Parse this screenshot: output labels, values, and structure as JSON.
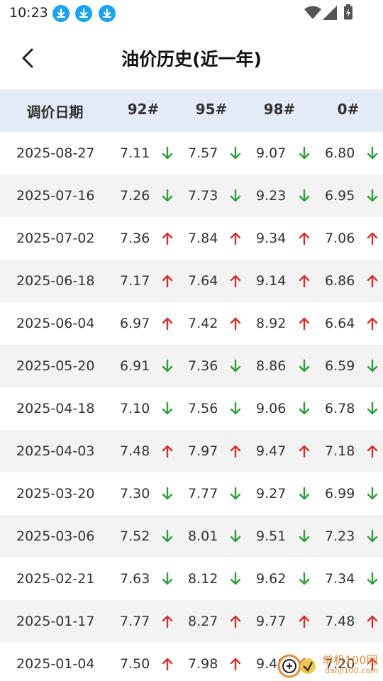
{
  "status_bar": {
    "time": "10:23",
    "notification_icons": [
      "download-icon",
      "download-icon",
      "download-icon"
    ],
    "right_icons": [
      "wifi-icon",
      "signal-icon",
      "battery-charging-icon"
    ]
  },
  "header": {
    "title": "油价历史(近一年)",
    "back_icon": "chevron-left-icon"
  },
  "table": {
    "columns": [
      "调价日期",
      "92#",
      "95#",
      "98#",
      "0#"
    ],
    "colors": {
      "up": "#d32f2f",
      "down": "#2e9d3a",
      "header_bg": "#e4eaf6",
      "alt_row_bg": "#f3f3f3"
    },
    "rows": [
      {
        "date": "2025-08-27",
        "p92": "7.11",
        "p95": "7.57",
        "p98": "9.07",
        "p0": "6.80",
        "trend": "down"
      },
      {
        "date": "2025-07-16",
        "p92": "7.26",
        "p95": "7.73",
        "p98": "9.23",
        "p0": "6.95",
        "trend": "down"
      },
      {
        "date": "2025-07-02",
        "p92": "7.36",
        "p95": "7.84",
        "p98": "9.34",
        "p0": "7.06",
        "trend": "up"
      },
      {
        "date": "2025-06-18",
        "p92": "7.17",
        "p95": "7.64",
        "p98": "9.14",
        "p0": "6.86",
        "trend": "up"
      },
      {
        "date": "2025-06-04",
        "p92": "6.97",
        "p95": "7.42",
        "p98": "8.92",
        "p0": "6.64",
        "trend": "up"
      },
      {
        "date": "2025-05-20",
        "p92": "6.91",
        "p95": "7.36",
        "p98": "8.86",
        "p0": "6.59",
        "trend": "down"
      },
      {
        "date": "2025-04-18",
        "p92": "7.10",
        "p95": "7.56",
        "p98": "9.06",
        "p0": "6.78",
        "trend": "down"
      },
      {
        "date": "2025-04-03",
        "p92": "7.48",
        "p95": "7.97",
        "p98": "9.47",
        "p0": "7.18",
        "trend": "up"
      },
      {
        "date": "2025-03-20",
        "p92": "7.30",
        "p95": "7.77",
        "p98": "9.27",
        "p0": "6.99",
        "trend": "down"
      },
      {
        "date": "2025-03-06",
        "p92": "7.52",
        "p95": "8.01",
        "p98": "9.51",
        "p0": "7.23",
        "trend": "down"
      },
      {
        "date": "2025-02-21",
        "p92": "7.63",
        "p95": "8.12",
        "p98": "9.62",
        "p0": "7.34",
        "trend": "down"
      },
      {
        "date": "2025-01-17",
        "p92": "7.77",
        "p95": "8.27",
        "p98": "9.77",
        "p0": "7.48",
        "trend": "up"
      },
      {
        "date": "2025-01-04",
        "p92": "7.50",
        "p95": "7.98",
        "p98": "9.48",
        "p0": "7.20",
        "trend": "up"
      }
    ]
  },
  "watermark": {
    "text": "单机100网",
    "sub": "danji100.com"
  }
}
